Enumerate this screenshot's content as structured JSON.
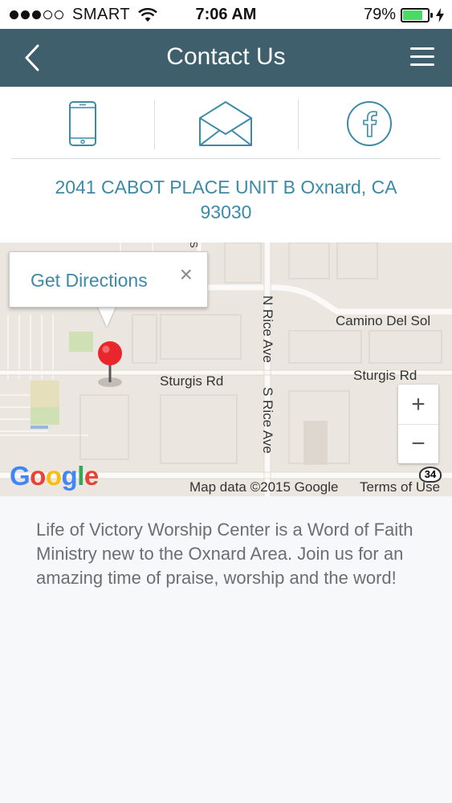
{
  "status_bar": {
    "carrier": "SMART",
    "time": "7:06 AM",
    "battery_percent": "79%",
    "battery_level": 0.79,
    "signal_bars_filled": 3,
    "signal_bars_total": 5
  },
  "nav": {
    "title": "Contact Us",
    "back_icon": "chevron-left-icon",
    "menu_icon": "hamburger-menu-icon"
  },
  "contact": {
    "icons": [
      "phone-icon",
      "email-icon",
      "facebook-icon"
    ],
    "address": "2041 CABOT PLACE UNIT B Oxnard, CA 93030"
  },
  "map": {
    "popup_text": "Get Directions",
    "popup_close": "×",
    "labels": {
      "camino_del_sol": "Camino Del Sol",
      "sturgis_rd_left": "Sturgis Rd",
      "sturgis_rd_right": "Sturgis Rd",
      "n_rice_ave": "N Rice Ave",
      "s_rice_ave": "S Rice Ave",
      "s_edge": "S"
    },
    "zoom_in": "+",
    "zoom_out": "−",
    "google": "Google",
    "map_data": "Map data ©2015 Google",
    "terms": "Terms of Use",
    "route_shield": "34"
  },
  "description": "Life of Victory Worship Center is a Word of Faith Ministry new to the Oxnard Area. Join us for an amazing time of praise, worship and the word!",
  "colors": {
    "nav_bg": "#3e5f6b",
    "accent": "#3b8aa8",
    "text_muted": "#6a6f73",
    "battery": "#4cd964",
    "pin": "#e8262c"
  }
}
